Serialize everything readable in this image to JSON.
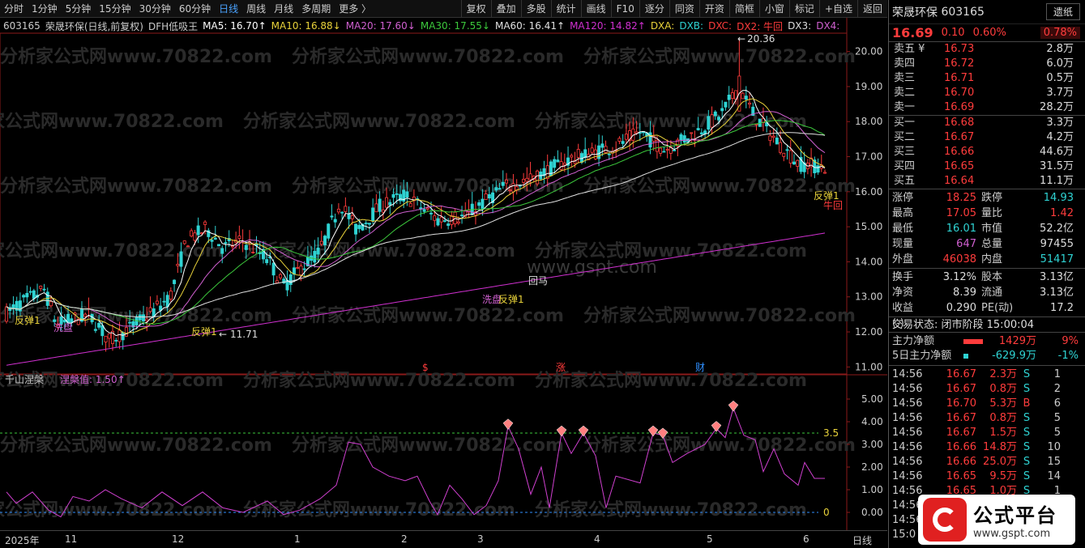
{
  "periods": [
    "分时",
    "1分钟",
    "5分钟",
    "15分钟",
    "30分钟",
    "60分钟",
    "日线",
    "周线",
    "月线",
    "多周期",
    "更多 〉"
  ],
  "active_period": "日线",
  "tools": [
    "复权",
    "叠加",
    "多股",
    "统计",
    "画线",
    "F10",
    "逐分",
    "同资",
    "开资",
    "简框",
    "小窗",
    "标记",
    "+自选",
    "返回"
  ],
  "legend": {
    "code": "603165",
    "name_info": "荣晟环保(日线,前复权)",
    "indicator": "DFH低吸王",
    "ma5": "MA5: 16.70↑",
    "ma10": "MA10: 16.88↓",
    "ma20": "MA20: 17.60↓",
    "ma30": "MA30: 17.55↓",
    "ma60": "MA60: 16.41↑",
    "ma120": "MA120: 14.82↑",
    "dxa": "DXA:",
    "dxb": "DXB:",
    "dxc": "DXC:",
    "dx2": "DX2: 牛回",
    "dx3": "DX3:",
    "dx4": "DX4:"
  },
  "colors": {
    "up": "#ff3c3c",
    "down": "#2fd3d3",
    "ma5": "#ffffff",
    "ma10": "#e8d23a",
    "ma20": "#d060d0",
    "ma30": "#3cc83c",
    "ma60": "#e0e0e0",
    "ma120": "#d030d0",
    "osc": "#d040d0"
  },
  "main_axis": {
    "ticks": [
      "20.00",
      "19.00",
      "18.00",
      "17.00",
      "16.00",
      "15.00",
      "14.00",
      "13.00",
      "12.00",
      "11.00"
    ],
    "min": 10.8,
    "max": 20.5
  },
  "annotations": {
    "high": "20.36",
    "low": "11.71",
    "signals": [
      "反弹1",
      "洗盘",
      "反弹1",
      "洗盘",
      "反弹1",
      "回马",
      "反弹1"
    ],
    "niuhui": "牛回",
    "events": [
      "$",
      "涨",
      "财"
    ]
  },
  "watermarks": [
    "分析家公式网www.70822.com",
    "www.gspt.com"
  ],
  "sub": {
    "title": "千山涅槃",
    "value_label": "涅槃值: 1.50↑",
    "ticks": [
      "5.00",
      "4.00",
      "3.00",
      "2.00",
      "1.00",
      "0.00"
    ],
    "level_35": "3.5",
    "level_0": "0"
  },
  "time_axis": {
    "labels": [
      "2025年",
      "11",
      "12",
      "1",
      "2",
      "3",
      "4",
      "5",
      "6"
    ],
    "period": "日线"
  },
  "quote": {
    "name": "荣晟环保",
    "code": "603165",
    "btn": "遗纸",
    "price": "16.69",
    "change": "0.10",
    "pct": "0.60%",
    "pct2": "0.78%",
    "sell": [
      {
        "l": "卖五 ¥",
        "p": "16.73",
        "v": "2.8万"
      },
      {
        "l": "卖四",
        "p": "16.72",
        "v": "6.0万"
      },
      {
        "l": "卖三",
        "p": "16.71",
        "v": "0.5万"
      },
      {
        "l": "卖二",
        "p": "16.70",
        "v": "3.7万"
      },
      {
        "l": "卖一",
        "p": "16.69",
        "v": "28.2万"
      }
    ],
    "buy": [
      {
        "l": "买一",
        "p": "16.68",
        "v": "3.3万"
      },
      {
        "l": "买二",
        "p": "16.67",
        "v": "4.2万"
      },
      {
        "l": "买三",
        "p": "16.66",
        "v": "44.6万"
      },
      {
        "l": "买四",
        "p": "16.65",
        "v": "31.5万"
      },
      {
        "l": "买五",
        "p": "16.64",
        "v": "11.1万"
      }
    ],
    "stats": [
      [
        "涨停",
        "18.25",
        "r",
        "跌停",
        "14.93",
        "g"
      ],
      [
        "最高",
        "17.05",
        "r",
        "量比",
        "1.42",
        "r"
      ],
      [
        "最低",
        "16.01",
        "g",
        "市值",
        "52.2亿",
        "w"
      ],
      [
        "现量",
        "647",
        "p",
        "总量",
        "97455",
        "w"
      ],
      [
        "外盘",
        "46038",
        "r",
        "内盘",
        "51417",
        "g"
      ]
    ],
    "stats2": [
      [
        "换手",
        "3.12%",
        "w",
        "股本",
        "3.13亿",
        "w"
      ],
      [
        "净资",
        "8.39",
        "w",
        "流通",
        "3.13亿",
        "w"
      ],
      [
        "收益(-)",
        "0.290",
        "w",
        "PE(动)",
        "17.2",
        "w"
      ]
    ],
    "trade_status": "交易状态: 闭市阶段 15:00:04",
    "flow": [
      {
        "l": "主力净额",
        "v": "1429万",
        "p": "9%",
        "c": "#ff3c3c"
      },
      {
        "l": "5日主力净额",
        "v": "-629.9万",
        "p": "-1%",
        "c": "#2fd3d3"
      }
    ],
    "ticks": [
      {
        "t": "14:56",
        "p": "16.67",
        "v": "2.3万",
        "s": "S",
        "n": "1"
      },
      {
        "t": "14:56",
        "p": "16.67",
        "v": "0.8万",
        "s": "S",
        "n": "2"
      },
      {
        "t": "14:56",
        "p": "16.70",
        "v": "5.3万",
        "s": "B",
        "n": "6"
      },
      {
        "t": "14:56",
        "p": "16.67",
        "v": "0.8万",
        "s": "S",
        "n": "5"
      },
      {
        "t": "14:56",
        "p": "16.67",
        "v": "1.5万",
        "s": "S",
        "n": "5"
      },
      {
        "t": "14:56",
        "p": "16.66",
        "v": "14.8万",
        "s": "S",
        "n": "10"
      },
      {
        "t": "14:56",
        "p": "16.66",
        "v": "25.0万",
        "s": "S",
        "n": "15"
      },
      {
        "t": "14:56",
        "p": "16.65",
        "v": "9.5万",
        "s": "S",
        "n": "14"
      },
      {
        "t": "14:56",
        "p": "16.65",
        "v": "1.0万",
        "s": "S",
        "n": "1"
      },
      {
        "t": "14:56",
        "p": "",
        "v": "",
        "s": "",
        "n": ""
      },
      {
        "t": "14:56",
        "p": "",
        "v": "",
        "s": "",
        "n": ""
      },
      {
        "t": "15:0",
        "p": "",
        "v": "",
        "s": "",
        "n": ""
      }
    ]
  },
  "logo": {
    "title": "公式平台",
    "url": "www.gspt.com"
  }
}
